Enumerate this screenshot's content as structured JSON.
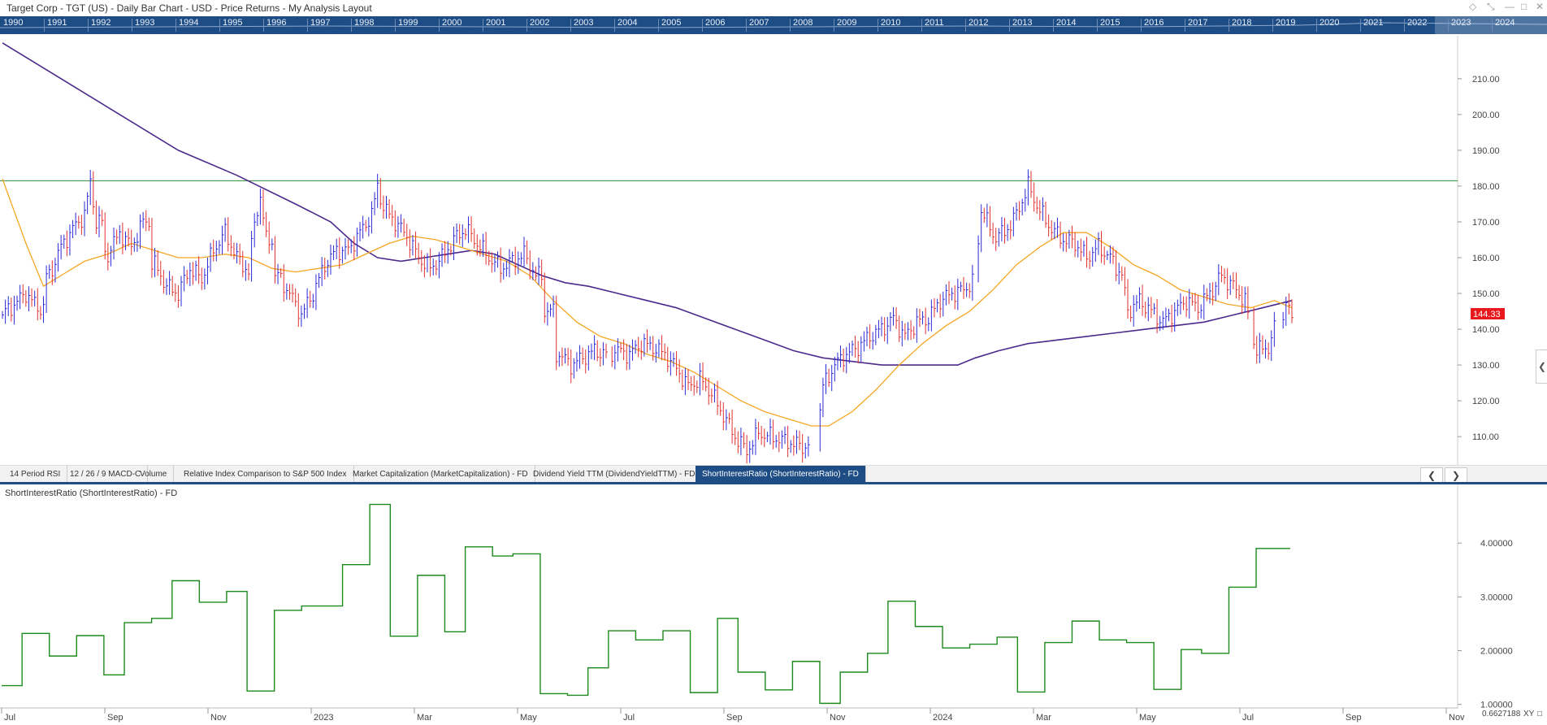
{
  "window": {
    "title": "Target Corp - TGT (US) - Daily Bar Chart - USD - Price Returns - My Analysis Layout"
  },
  "timeline_years": [
    "1990",
    "1991",
    "1992",
    "1993",
    "1994",
    "1995",
    "1996",
    "1997",
    "1998",
    "1999",
    "2000",
    "2001",
    "2002",
    "2003",
    "2004",
    "2005",
    "2006",
    "2007",
    "2008",
    "2009",
    "2010",
    "2011",
    "2012",
    "2013",
    "2014",
    "2015",
    "2016",
    "2017",
    "2018",
    "2019",
    "2020",
    "2021",
    "2022",
    "2023",
    "2024"
  ],
  "tabs": [
    {
      "label": "14 Period RSI"
    },
    {
      "label": "12 / 26 / 9 MACD-C"
    },
    {
      "label": "Volume"
    },
    {
      "label": "Relative Index Comparison to S&P 500 Index"
    },
    {
      "label": "Market Capitalization (MarketCapitalization) - FD"
    },
    {
      "label": "Dividend Yield TTM (DividendYieldTTM) - FD"
    },
    {
      "label": "ShortInterestRatio (ShortInterestRatio) - FD",
      "active": true
    }
  ],
  "lower_panel_title": "ShortInterestRatio (ShortInterestRatio) - FD",
  "corner": {
    "value": "0.6627188",
    "xy": "XY"
  },
  "colors": {
    "accent": "#1e4d86",
    "up_bar": "#2b2bd6",
    "down_bar": "#e03030",
    "ma_short": "#f5a623",
    "ma_long": "#4b2a8c",
    "resistance": "#2e8b2e",
    "sir_line": "#1d8a1d",
    "last_price_badge": "#e8191c"
  },
  "chart_data": [
    {
      "type": "line",
      "x_ticks": [
        "Jul",
        "Sep",
        "Nov",
        "2023",
        "Mar",
        "May",
        "Jul",
        "Sep",
        "Nov",
        "2024",
        "Mar",
        "May",
        "Jul",
        "Sep",
        "Nov"
      ],
      "ylim": [
        103,
        222
      ],
      "y_ticks": [
        "110.00",
        "120.00",
        "130.00",
        "140.00",
        "150.00",
        "160.00",
        "170.00",
        "180.00",
        "190.00",
        "200.00",
        "210.00"
      ],
      "last_price": "144.33",
      "horizontal_line": 181.5,
      "price_path": [
        [
          0,
          144
        ],
        [
          4,
          150
        ],
        [
          6,
          146
        ],
        [
          8,
          155
        ],
        [
          10,
          163
        ],
        [
          12,
          168
        ],
        [
          14,
          172
        ],
        [
          15,
          181
        ],
        [
          16,
          170
        ],
        [
          18,
          161
        ],
        [
          20,
          167
        ],
        [
          22,
          163
        ],
        [
          24,
          170
        ],
        [
          26,
          158
        ],
        [
          28,
          152
        ],
        [
          30,
          150
        ],
        [
          32,
          157
        ],
        [
          34,
          154
        ],
        [
          36,
          162
        ],
        [
          38,
          167
        ],
        [
          40,
          160
        ],
        [
          42,
          156
        ],
        [
          43,
          170
        ],
        [
          44,
          177
        ],
        [
          45,
          165
        ],
        [
          47,
          155
        ],
        [
          49,
          150
        ],
        [
          51,
          144
        ],
        [
          53,
          150
        ],
        [
          55,
          158
        ],
        [
          57,
          162
        ],
        [
          59,
          162
        ],
        [
          61,
          167
        ],
        [
          63,
          172
        ],
        [
          64,
          180
        ],
        [
          65,
          174
        ],
        [
          67,
          170
        ],
        [
          69,
          166
        ],
        [
          71,
          160
        ],
        [
          73,
          157
        ],
        [
          75,
          160
        ],
        [
          77,
          165
        ],
        [
          79,
          168
        ],
        [
          81,
          164
        ],
        [
          83,
          160
        ],
        [
          85,
          157
        ],
        [
          87,
          159
        ],
        [
          89,
          161
        ],
        [
          91,
          155
        ],
        [
          93,
          145
        ],
        [
          95,
          133
        ],
        [
          97,
          130
        ],
        [
          99,
          132
        ],
        [
          101,
          134
        ],
        [
          103,
          133
        ],
        [
          105,
          134
        ],
        [
          107,
          133
        ],
        [
          109,
          136
        ],
        [
          111,
          135
        ],
        [
          113,
          133
        ],
        [
          115,
          129
        ],
        [
          117,
          124
        ],
        [
          119,
          126
        ],
        [
          121,
          122
        ],
        [
          123,
          116
        ],
        [
          125,
          110
        ],
        [
          127,
          106
        ],
        [
          129,
          111
        ],
        [
          131,
          110
        ],
        [
          133,
          109
        ],
        [
          135,
          108
        ],
        [
          137,
          107
        ],
        [
          139,
          111
        ],
        [
          140,
          124
        ],
        [
          142,
          130
        ],
        [
          144,
          133
        ],
        [
          146,
          135
        ],
        [
          148,
          138
        ],
        [
          150,
          140
        ],
        [
          152,
          143
        ],
        [
          154,
          138
        ],
        [
          156,
          142
        ],
        [
          158,
          143
        ],
        [
          160,
          148
        ],
        [
          162,
          150
        ],
        [
          164,
          151
        ],
        [
          166,
          154
        ],
        [
          167,
          174
        ],
        [
          169,
          166
        ],
        [
          171,
          167
        ],
        [
          173,
          172
        ],
        [
          175,
          180
        ],
        [
          177,
          173
        ],
        [
          179,
          168
        ],
        [
          181,
          165
        ],
        [
          183,
          164
        ],
        [
          185,
          160
        ],
        [
          187,
          163
        ],
        [
          189,
          160
        ],
        [
          191,
          155
        ],
        [
          192,
          145
        ],
        [
          194,
          148
        ],
        [
          196,
          145
        ],
        [
          198,
          142
        ],
        [
          200,
          145
        ],
        [
          202,
          148
        ],
        [
          204,
          146
        ],
        [
          206,
          150
        ],
        [
          208,
          155
        ],
        [
          210,
          152
        ],
        [
          212,
          148
        ],
        [
          213,
          140
        ],
        [
          214,
          134
        ],
        [
          216,
          135
        ],
        [
          217,
          140
        ],
        [
          219,
          146
        ],
        [
          220,
          144.3
        ]
      ],
      "ma_short": [
        [
          0,
          182
        ],
        [
          4,
          164
        ],
        [
          7,
          152
        ],
        [
          10,
          155
        ],
        [
          14,
          159
        ],
        [
          18,
          161
        ],
        [
          22,
          164
        ],
        [
          26,
          162
        ],
        [
          30,
          160
        ],
        [
          34,
          160
        ],
        [
          38,
          161
        ],
        [
          42,
          160
        ],
        [
          46,
          157
        ],
        [
          50,
          156
        ],
        [
          54,
          157
        ],
        [
          58,
          158
        ],
        [
          62,
          161
        ],
        [
          66,
          164
        ],
        [
          70,
          166
        ],
        [
          74,
          165
        ],
        [
          78,
          163
        ],
        [
          82,
          161
        ],
        [
          86,
          159
        ],
        [
          90,
          155
        ],
        [
          94,
          148
        ],
        [
          98,
          142
        ],
        [
          102,
          138
        ],
        [
          106,
          136
        ],
        [
          110,
          133
        ],
        [
          114,
          131
        ],
        [
          118,
          128
        ],
        [
          122,
          124
        ],
        [
          126,
          120
        ],
        [
          130,
          117
        ],
        [
          134,
          115
        ],
        [
          138,
          113
        ],
        [
          141,
          113
        ],
        [
          145,
          117
        ],
        [
          149,
          123
        ],
        [
          153,
          130
        ],
        [
          157,
          136
        ],
        [
          161,
          141
        ],
        [
          165,
          145
        ],
        [
          169,
          151
        ],
        [
          173,
          158
        ],
        [
          177,
          163
        ],
        [
          181,
          167
        ],
        [
          185,
          167
        ],
        [
          189,
          163
        ],
        [
          193,
          158
        ],
        [
          197,
          155
        ],
        [
          201,
          151
        ],
        [
          205,
          149
        ],
        [
          209,
          147
        ],
        [
          213,
          146
        ],
        [
          217,
          148
        ],
        [
          220,
          146
        ]
      ],
      "ma_long": [
        [
          0,
          220
        ],
        [
          10,
          210
        ],
        [
          20,
          200
        ],
        [
          30,
          190
        ],
        [
          40,
          183
        ],
        [
          50,
          175
        ],
        [
          56,
          170
        ],
        [
          60,
          164
        ],
        [
          64,
          160
        ],
        [
          68,
          159
        ],
        [
          72,
          160
        ],
        [
          76,
          161
        ],
        [
          80,
          162
        ],
        [
          84,
          161
        ],
        [
          88,
          158
        ],
        [
          92,
          155
        ],
        [
          96,
          153
        ],
        [
          100,
          152
        ],
        [
          105,
          150
        ],
        [
          110,
          148
        ],
        [
          115,
          146
        ],
        [
          120,
          143
        ],
        [
          125,
          140
        ],
        [
          130,
          137
        ],
        [
          135,
          134
        ],
        [
          140,
          132
        ],
        [
          145,
          131
        ],
        [
          150,
          130
        ],
        [
          155,
          130
        ],
        [
          160,
          130
        ],
        [
          163,
          130
        ],
        [
          166,
          132
        ],
        [
          170,
          134
        ],
        [
          175,
          136
        ],
        [
          180,
          137
        ],
        [
          185,
          138
        ],
        [
          190,
          139
        ],
        [
          195,
          140
        ],
        [
          200,
          141
        ],
        [
          205,
          142
        ],
        [
          210,
          144
        ],
        [
          215,
          146
        ],
        [
          220,
          148
        ]
      ]
    },
    {
      "type": "line",
      "name": "ShortInterestRatio",
      "ylim": [
        0.95,
        5.0
      ],
      "y_ticks": [
        "1.00000",
        "2.00000",
        "3.00000",
        "4.00000"
      ],
      "steps": [
        [
          0,
          1.35
        ],
        [
          3,
          2.32
        ],
        [
          7,
          1.9
        ],
        [
          11,
          2.28
        ],
        [
          15,
          1.55
        ],
        [
          18,
          2.52
        ],
        [
          22,
          2.6
        ],
        [
          25,
          3.3
        ],
        [
          29,
          2.9
        ],
        [
          33,
          3.1
        ],
        [
          36,
          1.25
        ],
        [
          40,
          2.75
        ],
        [
          44,
          2.83
        ],
        [
          50,
          3.6
        ],
        [
          54,
          4.72
        ],
        [
          57,
          2.27
        ],
        [
          61,
          3.4
        ],
        [
          65,
          2.35
        ],
        [
          68,
          3.93
        ],
        [
          72,
          3.76
        ],
        [
          75,
          3.8
        ],
        [
          79,
          1.2
        ],
        [
          83,
          1.17
        ],
        [
          86,
          1.68
        ],
        [
          89,
          2.37
        ],
        [
          93,
          2.2
        ],
        [
          97,
          2.37
        ],
        [
          101,
          1.22
        ],
        [
          105,
          2.6
        ],
        [
          108,
          1.6
        ],
        [
          112,
          1.27
        ],
        [
          116,
          1.8
        ],
        [
          120,
          1.02
        ],
        [
          123,
          1.6
        ],
        [
          127,
          1.95
        ],
        [
          130,
          2.92
        ],
        [
          134,
          2.45
        ],
        [
          138,
          2.05
        ],
        [
          142,
          2.12
        ],
        [
          146,
          2.25
        ],
        [
          149,
          1.23
        ],
        [
          153,
          2.15
        ],
        [
          157,
          2.55
        ],
        [
          161,
          2.2
        ],
        [
          165,
          2.15
        ],
        [
          169,
          1.28
        ],
        [
          173,
          2.02
        ],
        [
          176,
          1.95
        ],
        [
          180,
          3.18
        ],
        [
          184,
          3.9
        ],
        [
          189,
          3.9
        ]
      ]
    }
  ]
}
